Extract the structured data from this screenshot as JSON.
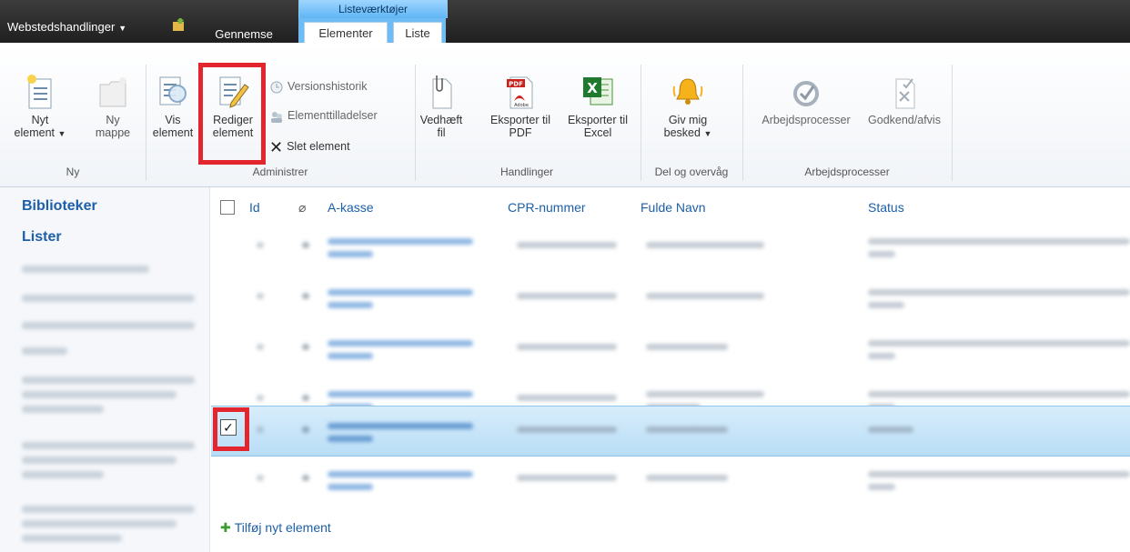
{
  "top": {
    "site_actions": "Webstedshandlinger",
    "tab_browse": "Gennemse",
    "contextual_group": "Listeværktøjer",
    "tab_items": "Elementer",
    "tab_list": "Liste"
  },
  "ribbon": {
    "new_item_line1": "Nyt",
    "new_item_line2": "element",
    "new_folder_line1": "Ny",
    "new_folder_line2": "mappe",
    "group_new": "Ny",
    "view_item_line1": "Vis",
    "view_item_line2": "element",
    "edit_item_line1": "Rediger",
    "edit_item_line2": "element",
    "version_history": "Versionshistorik",
    "item_permissions": "Elementtilladelser",
    "delete_item": "Slet element",
    "group_manage": "Administrer",
    "attach_file_line1": "Vedhæft",
    "attach_file_line2": "fil",
    "export_pdf_line1": "Eksporter til",
    "export_pdf_line2": "PDF",
    "export_excel_line1": "Eksporter til",
    "export_excel_line2": "Excel",
    "group_actions": "Handlinger",
    "alert_me_line1": "Giv mig",
    "alert_me_line2": "besked",
    "group_share": "Del og overvåg",
    "workflows": "Arbejdsprocesser",
    "approve_reject": "Godkend/afvis",
    "group_workflows": "Arbejdsprocesser",
    "pdf_badge": "PDF",
    "adobe_text": "Adobe"
  },
  "leftnav": {
    "libraries": "Biblioteker",
    "lists": "Lister"
  },
  "list": {
    "columns": [
      "Id",
      "A-kasse",
      "CPR-nummer",
      "Fulde Navn",
      "Status"
    ],
    "add_new": "Tilføj nyt element"
  },
  "colors": {
    "accent": "#1d5fa8",
    "highlight": "#e3262e",
    "selected_row": "#c6e4f8"
  }
}
